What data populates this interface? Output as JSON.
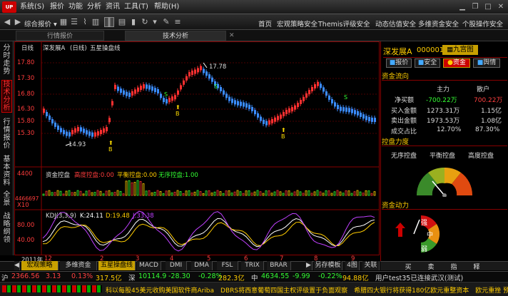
{
  "menubar": {
    "logo": "UP",
    "items": [
      "系统(S)",
      "报价",
      "功能",
      "分析",
      "资讯",
      "工具(T)",
      "帮助(H)"
    ]
  },
  "toolbar": {
    "menu_label": "综合报价",
    "nav": [
      "首页",
      "宏观策略安全",
      "Themis评级安全",
      "动态估值安全",
      "多维资金安全",
      "个股操作安全"
    ]
  },
  "tabs": [
    "行情报价",
    "技术分析"
  ],
  "sidebar": [
    "分时走势",
    "技术分析",
    "行情报价",
    "基本资料",
    "全景",
    "战略纲领"
  ],
  "chart": {
    "header": {
      "period": "日线",
      "name": "深发展A",
      "sub": "(日线)",
      "indicator": "五星操盘线"
    },
    "price_axis": [
      "17.80",
      "17.30",
      "16.80",
      "16.30",
      "15.80",
      "15.30"
    ],
    "high_label": "17.78",
    "low_label": "14.93",
    "buy_marker": "B",
    "sell_marker": "S",
    "vol_panel": {
      "title": "资金控盘",
      "items": [
        "高度控盘:0.00",
        "平衡控盘:0.00",
        "无序控盘:1.00"
      ],
      "axis": [
        "4400",
        "4466697",
        "X10"
      ]
    },
    "kdj_panel": {
      "title": "KDJ(3,3,9)",
      "k": "K:24.11",
      "d": "D:19.48",
      "j": "J:33.38",
      "axis": [
        "80.00",
        "40.00"
      ]
    },
    "date_axis": {
      "year": "2011年",
      "months": [
        "12",
        "2",
        "3",
        "4",
        "5",
        "6",
        "7",
        "8",
        "9"
      ]
    }
  },
  "bottom_tabs": [
    "宏观策略",
    "多维资金",
    "五星操盘线",
    "MACD",
    "DMI",
    "DMA",
    "FSL",
    "TRIX",
    "BRAR",
    "另存模板",
    "4图",
    "关联"
  ],
  "right": {
    "stock": {
      "name": "深发展A",
      "code": "000001",
      "badge": "九宫图"
    },
    "buttons": [
      "报价",
      "安全",
      "资金",
      "舆情"
    ],
    "flow_title": "资金流向",
    "flow_cols": [
      "主力",
      "散户"
    ],
    "flow_rows": [
      {
        "label": "净买额",
        "main": "-700.22万",
        "retail": "700.22万"
      },
      {
        "label": "买入金额",
        "main": "1273.31万",
        "retail": "1.15亿"
      },
      {
        "label": "卖出金额",
        "main": "1973.53万",
        "retail": "1.08亿"
      },
      {
        "label": "成交占比",
        "main": "12.70%",
        "retail": "87.30%"
      }
    ],
    "control_title": "控盘力度",
    "control_items": [
      "无序控盘",
      "平衡控盘",
      "高度控盘"
    ],
    "power_title": "资金动力",
    "power_levels": [
      "强",
      "中",
      "弱"
    ]
  },
  "status": {
    "sh": "沪",
    "sh_val": "2366.56",
    "sh_chg": "3.13",
    "sh_pct": "0.13%",
    "sh_amt": "317.5亿",
    "sz": "深",
    "sz_val": "10114.9",
    "sz_chg": "-28.30",
    "sz_pct": "-0.28%",
    "sz_amt": "282.3亿",
    "zx": "中",
    "zx_val": "4634.55",
    "zx_chg": "-9.99",
    "zx_pct": "-0.22%",
    "zx_amt": "94.88亿",
    "user": "用户test35已连接武汉(测试)",
    "right_btns": [
      "买",
      "卖",
      "指",
      "释"
    ]
  },
  "news": "科以每股45美元收购美国软件商Ariba　DBRS将西意葡萄四国主权评级置于负面观察　希腊四大银行将获得180亿欧元重整资本　欧元重挫 预算下拉建议"
}
